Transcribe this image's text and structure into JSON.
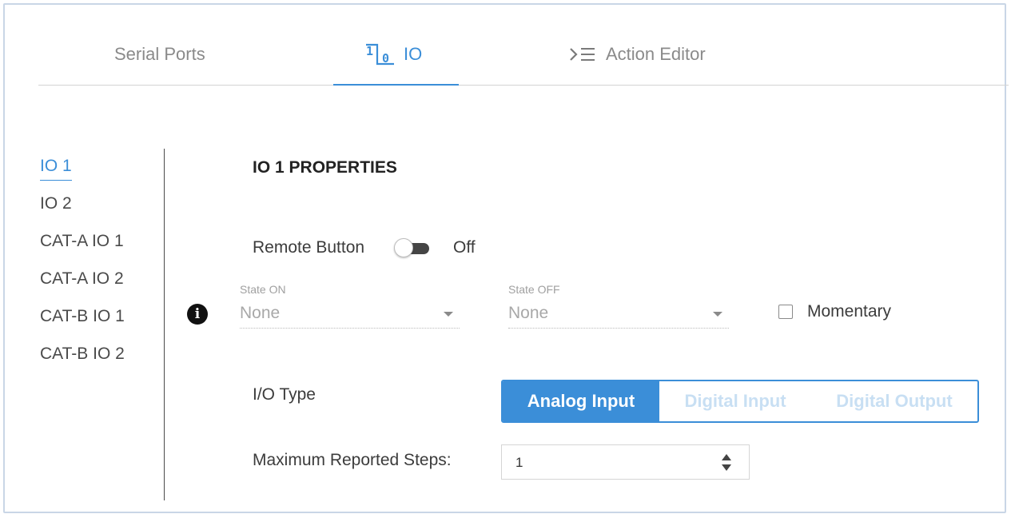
{
  "tabs": [
    {
      "label": "Serial Ports",
      "icon": "",
      "active": false
    },
    {
      "label": "IO",
      "icon": "io-icon",
      "active": true
    },
    {
      "label": "Action Editor",
      "icon": "action-editor-icon",
      "active": false
    }
  ],
  "sidebar": {
    "items": [
      {
        "label": "IO 1",
        "active": true
      },
      {
        "label": "IO 2"
      },
      {
        "label": "CAT-A IO 1"
      },
      {
        "label": "CAT-A IO 2"
      },
      {
        "label": "CAT-B IO 1"
      },
      {
        "label": "CAT-B IO 2"
      }
    ]
  },
  "properties": {
    "title": "IO 1 PROPERTIES",
    "remote_button": {
      "label": "Remote Button",
      "state": "Off"
    },
    "state_on": {
      "label": "State ON",
      "value": "None"
    },
    "state_off": {
      "label": "State OFF",
      "value": "None"
    },
    "momentary": {
      "label": "Momentary",
      "checked": false
    },
    "io_type": {
      "label": "I/O Type",
      "options": [
        "Analog Input",
        "Digital Input",
        "Digital Output"
      ],
      "selected": "Analog Input"
    },
    "max_steps": {
      "label": "Maximum Reported Steps:",
      "value": "1"
    }
  },
  "colors": {
    "accent": "#3b8ed8",
    "text": "#3c3c3c",
    "muted": "#8a8a8a"
  }
}
